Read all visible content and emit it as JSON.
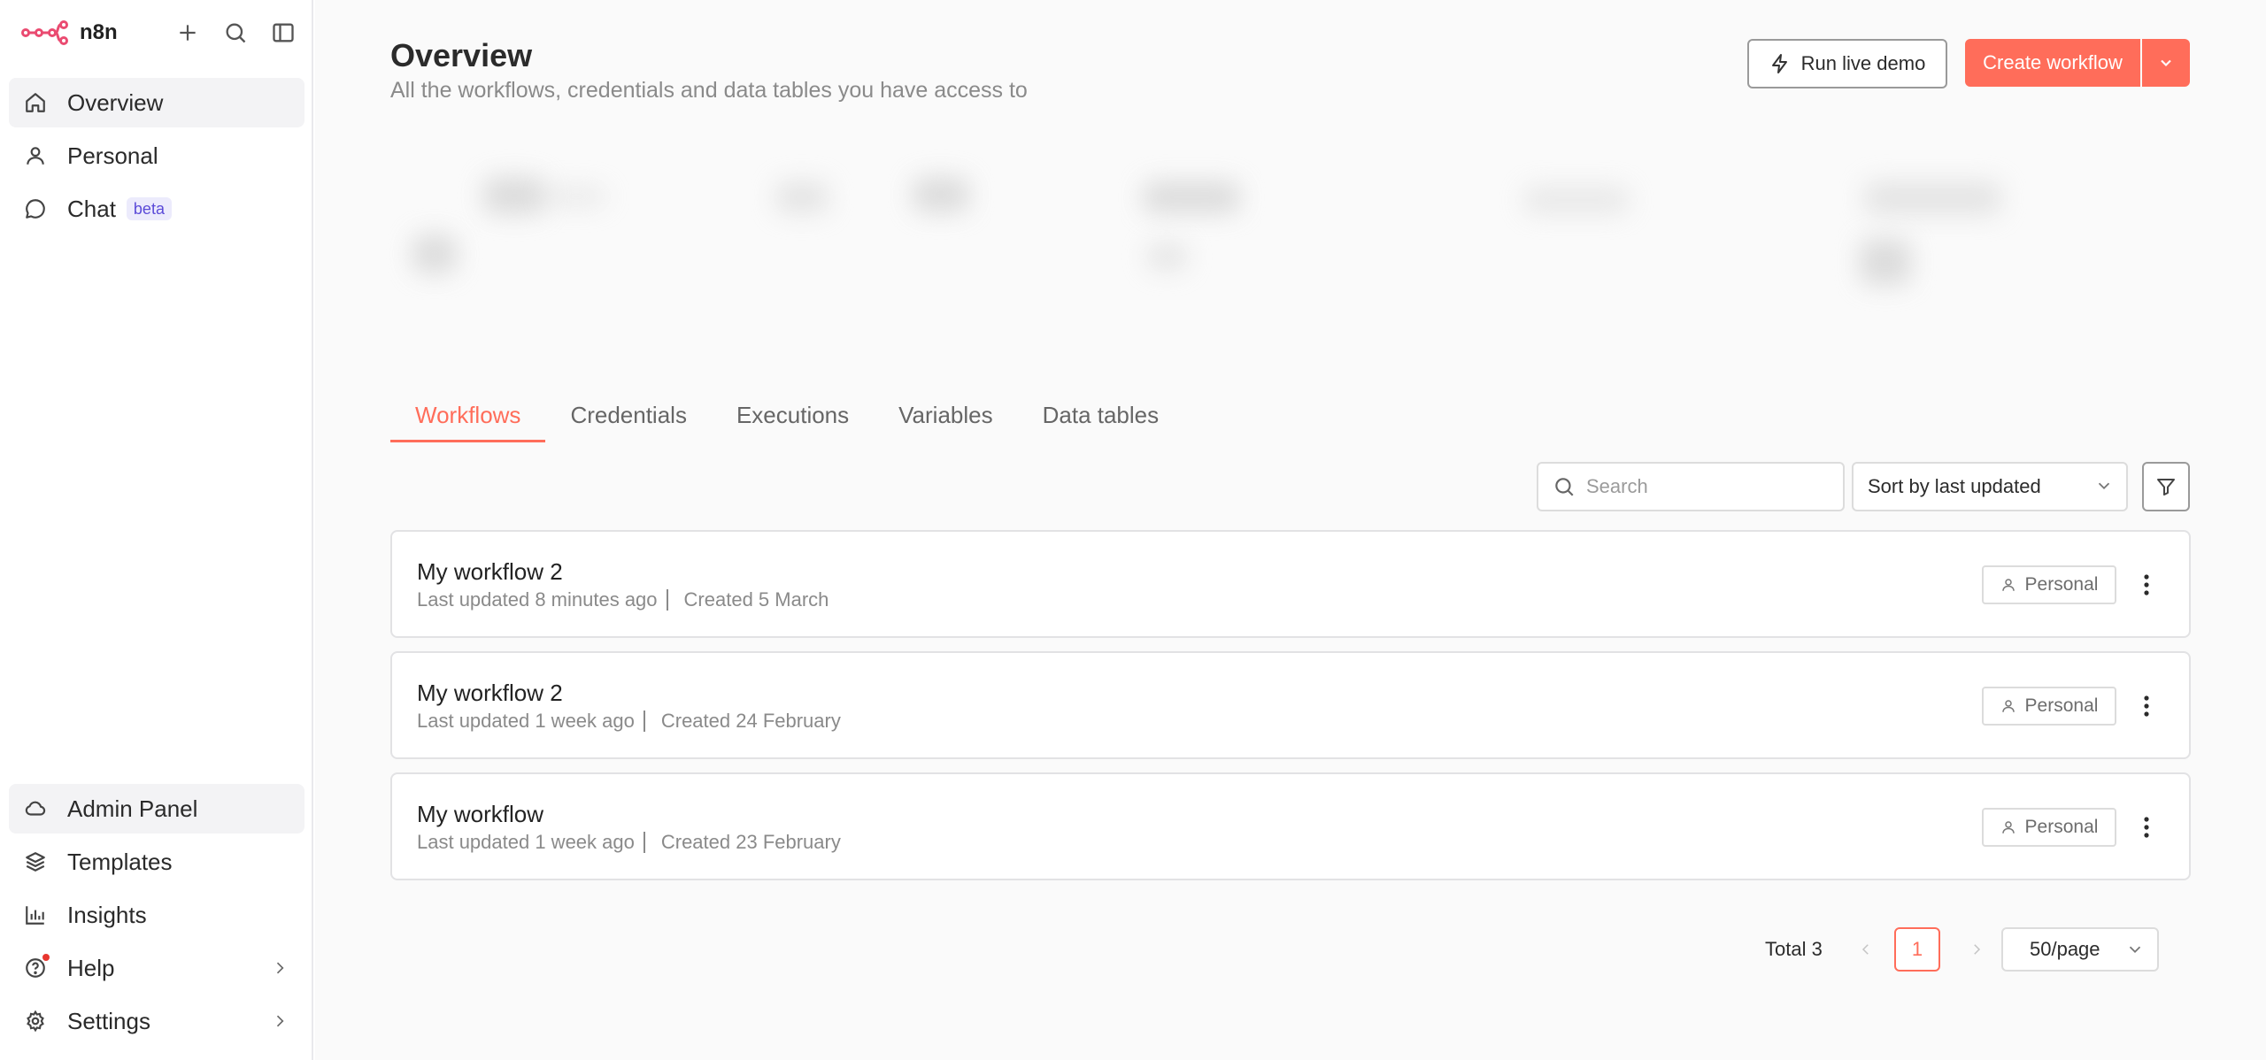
{
  "app": {
    "name": "n8n"
  },
  "sidebar": {
    "nav": [
      {
        "label": "Overview",
        "icon": "home-icon"
      },
      {
        "label": "Personal",
        "icon": "user-icon"
      },
      {
        "label": "Chat",
        "icon": "chat-icon",
        "badge": "beta"
      }
    ],
    "bottom": [
      {
        "label": "Admin Panel",
        "icon": "cloud-icon"
      },
      {
        "label": "Templates",
        "icon": "box-icon"
      },
      {
        "label": "Insights",
        "icon": "bar-chart-icon"
      },
      {
        "label": "Help",
        "icon": "help-icon"
      },
      {
        "label": "Settings",
        "icon": "gear-icon"
      }
    ]
  },
  "header": {
    "title": "Overview",
    "subtitle": "All the workflows, credentials and data tables you have access to",
    "run_demo_label": "Run live demo",
    "create_label": "Create workflow"
  },
  "tabs": [
    "Workflows",
    "Credentials",
    "Executions",
    "Variables",
    "Data tables"
  ],
  "filters": {
    "search_placeholder": "Search",
    "sort_label": "Sort by last updated"
  },
  "workflows": [
    {
      "name": "My workflow 2",
      "updated": "Last updated 8 minutes ago",
      "created": "Created 5 March",
      "owner": "Personal"
    },
    {
      "name": "My workflow 2",
      "updated": "Last updated 1 week ago",
      "created": "Created 24 February",
      "owner": "Personal"
    },
    {
      "name": "My workflow",
      "updated": "Last updated 1 week ago",
      "created": "Created 23 February",
      "owner": "Personal"
    }
  ],
  "pagination": {
    "total": "Total 3",
    "current_page": "1",
    "per_page": "50/page"
  },
  "colors": {
    "accent": "#ff6d5a",
    "beta_badge": "#5b4bd8",
    "notification_dot": "#e8362f"
  }
}
